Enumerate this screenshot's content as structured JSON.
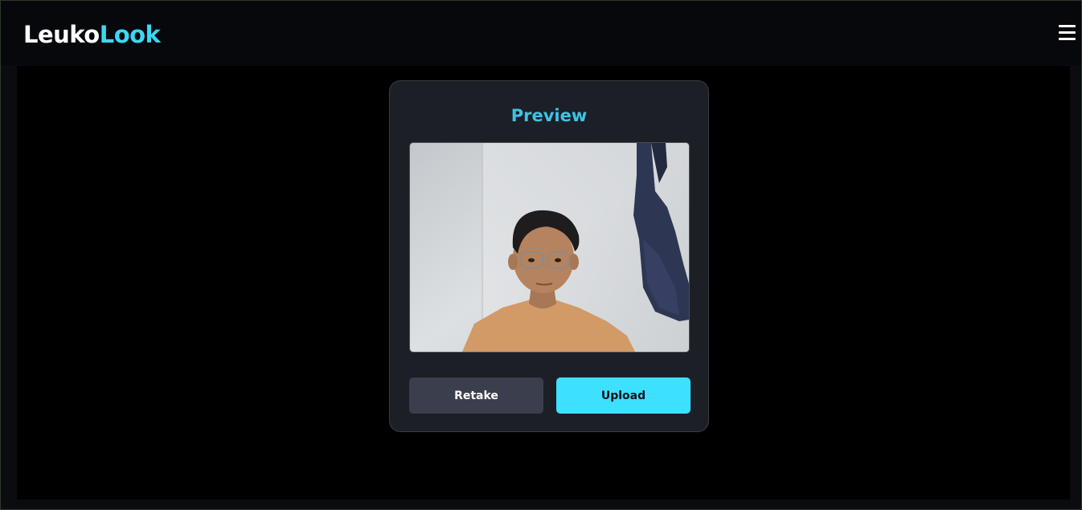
{
  "navbar": {
    "brand_part_1": "Leuko",
    "brand_part_2": "Look",
    "menu_icon": "hamburger-menu-icon"
  },
  "preview_card": {
    "title": "Preview",
    "image_alt": "captured-photo",
    "retake_label": "Retake",
    "upload_label": "Upload"
  },
  "colors": {
    "accent": "#3dd6f2",
    "upload_button": "#3de0ff",
    "retake_button": "#3b3e4c",
    "card_background": "#1d1f27",
    "page_background": "#000000"
  }
}
